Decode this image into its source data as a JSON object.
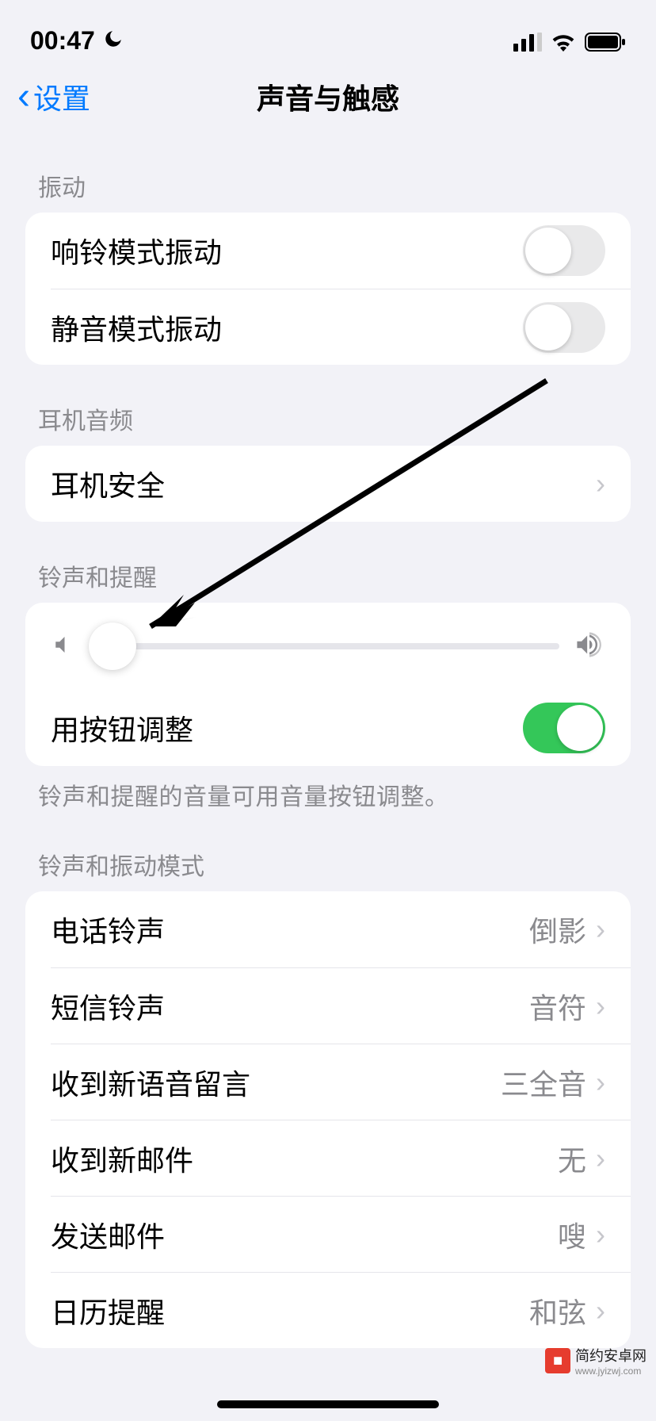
{
  "status": {
    "time": "00:47"
  },
  "nav": {
    "back_label": "设置",
    "title": "声音与触感"
  },
  "vibration": {
    "header": "振动",
    "ring_label": "响铃模式振动",
    "silent_label": "静音模式振动"
  },
  "headphone": {
    "header": "耳机音频",
    "safety_label": "耳机安全"
  },
  "ringer": {
    "header": "铃声和提醒",
    "button_adjust_label": "用按钮调整",
    "footer": "铃声和提醒的音量可用音量按钮调整。",
    "slider_value": 0
  },
  "patterns": {
    "header": "铃声和振动模式",
    "items": [
      {
        "label": "电话铃声",
        "value": "倒影"
      },
      {
        "label": "短信铃声",
        "value": "音符"
      },
      {
        "label": "收到新语音留言",
        "value": "三全音"
      },
      {
        "label": "收到新邮件",
        "value": "无"
      },
      {
        "label": "发送邮件",
        "value": "嗖"
      },
      {
        "label": "日历提醒",
        "value": "和弦"
      }
    ]
  },
  "watermark": {
    "name": "简约安卓网",
    "url": "www.jyizwj.com"
  }
}
